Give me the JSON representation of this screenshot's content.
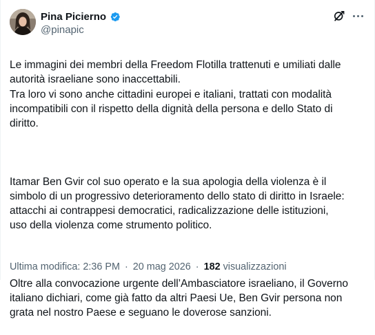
{
  "author": {
    "name": "Pina Picierno",
    "handle": "@pinapic",
    "verified": true,
    "verified_color": "#1d9bf0"
  },
  "actions": {
    "grok_icon": "grok-icon",
    "more_icon": "more-horizontal-icon"
  },
  "tweet": {
    "paragraphs": [
      "Le immagini dei membri della Freedom Flotilla trattenuti e umiliati dalle\nautorità israeliane sono inaccettabili.\nTra loro vi sono anche cittadini europei e italiani, trattati con modalità\nincompatibili con il rispetto della dignità della persona e dello Stato di\ndiritto.",
      "Itamar Ben Gvir col suo operato e la sua apologia della violenza è il\nsimbolo di un progressivo deterioramento dello stato di diritto in Israele:\nattacchi ai contrappesi democratici, radicalizzazione delle istituzioni,\nuso della violenza come strumento politico.",
      "Oltre alla convocazione urgente dell’Ambasciatore israeliano, il Governo\nitaliano dichiari, come già fatto da altri Paesi Ue, Ben Gvir persona non\ngrata nel nostro Paese e seguano le doverose sanzioni."
    ]
  },
  "meta": {
    "edited_label": "Ultima modifica:",
    "time": "2:36 PM",
    "separator": "·",
    "date": "20 mag 2026",
    "views_count": "182",
    "views_label": "visualizzazioni"
  }
}
